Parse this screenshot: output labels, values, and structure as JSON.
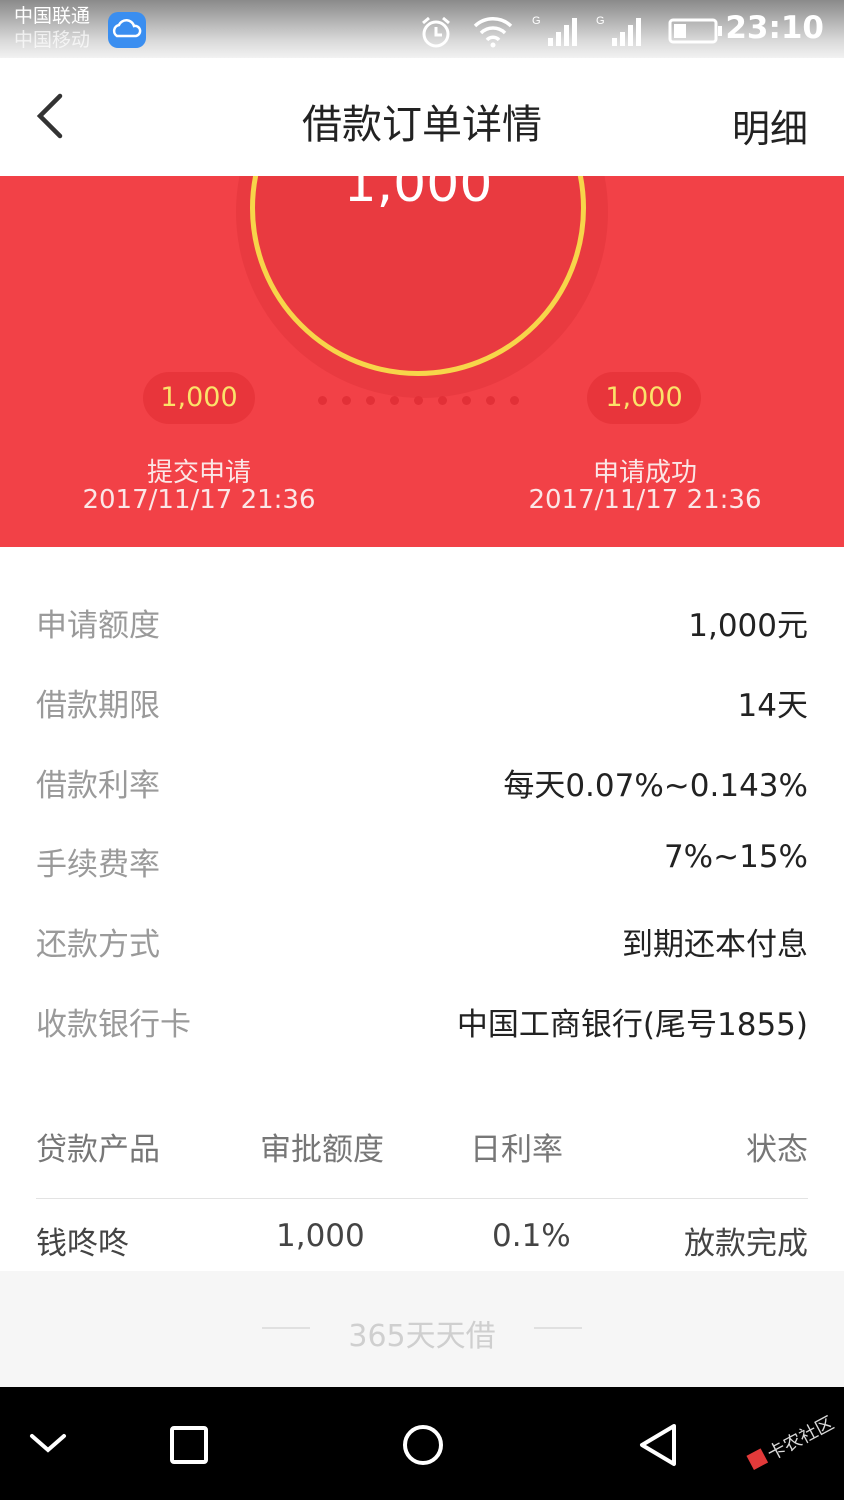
{
  "status_bar": {
    "carrier_1": "中国联通",
    "carrier_2": "中国移动",
    "time": "23:10",
    "icons": [
      "weather-cloud-icon",
      "alarm-icon",
      "wifi-icon",
      "signal-icon",
      "signal-icon",
      "battery-icon"
    ]
  },
  "nav": {
    "back_icon": "chevron-left-icon",
    "title": "借款订单详情",
    "right_label": "明细"
  },
  "hero": {
    "amount": "1,000",
    "accent_color": "#f24147",
    "ring_color": "#f7d54a",
    "steps": [
      {
        "amount": "1,000",
        "label": "提交申请",
        "date": "2017/11/17 21:36"
      },
      {
        "amount": "1,000",
        "label": "申请成功",
        "date": "2017/11/17 21:36"
      }
    ]
  },
  "details": [
    {
      "label": "申请额度",
      "value": "1,000元"
    },
    {
      "label": "借款期限",
      "value": "14天"
    },
    {
      "label": "借款利率",
      "value": "每天0.07%~0.143%"
    },
    {
      "label": "手续费率",
      "value": "7%~15%"
    },
    {
      "label": "还款方式",
      "value": "到期还本付息"
    },
    {
      "label": "收款银行卡",
      "value": "中国工商银行(尾号1855)"
    }
  ],
  "table": {
    "headers": [
      "贷款产品",
      "审批额度",
      "日利率",
      "状态"
    ],
    "rows": [
      [
        "钱咚咚",
        "1,000",
        "0.1%",
        "放款完成"
      ]
    ]
  },
  "footer": {
    "text": "365天天借"
  },
  "softkeys": {
    "icons": [
      "chevron-down-icon",
      "recents-square-icon",
      "home-circle-icon",
      "back-triangle-icon"
    ]
  },
  "watermark": "卡农社区"
}
